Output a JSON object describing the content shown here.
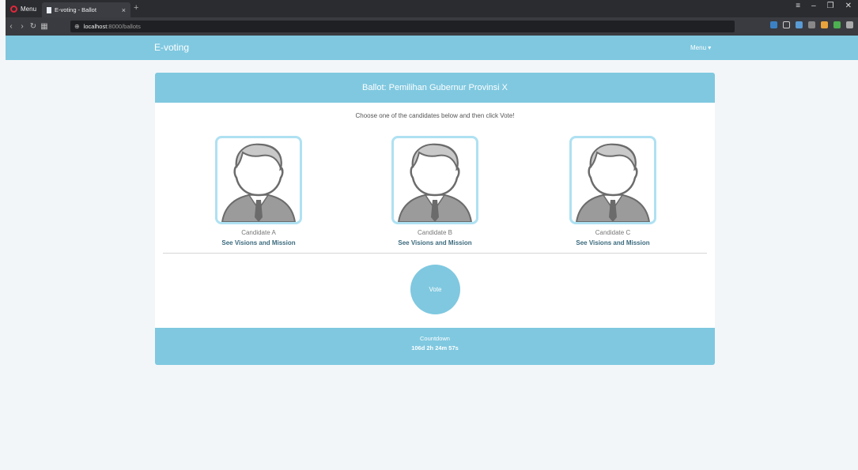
{
  "browser": {
    "menu_label": "Menu",
    "tab_title": "E-voting - Ballot",
    "tab_close": "×",
    "new_tab": "+",
    "url_host": "localhost",
    "url_rest": ":8000/ballots",
    "nav_icons": [
      "back-icon",
      "forward-icon",
      "reload-icon",
      "grid-icon"
    ]
  },
  "app": {
    "brand": "E-voting",
    "menu_label": "Menu ▾"
  },
  "ballot": {
    "header": "Ballot: Pemilihan Gubernur Provinsi X",
    "instruction": "Choose one of the candidates below and then click Vote!",
    "candidates": [
      {
        "name": "Candidate A",
        "link": "See Visions and Mission"
      },
      {
        "name": "Candidate B",
        "link": "See Visions and Mission"
      },
      {
        "name": "Candidate C",
        "link": "See Visions and Mission"
      }
    ],
    "vote_label": "Vote",
    "countdown_label": "Countdown",
    "countdown_value": "106d 2h 24m 57s"
  },
  "colors": {
    "accent": "#7fc8e0",
    "avatar_border": "#aee1f2",
    "link": "#3b6a7d"
  }
}
